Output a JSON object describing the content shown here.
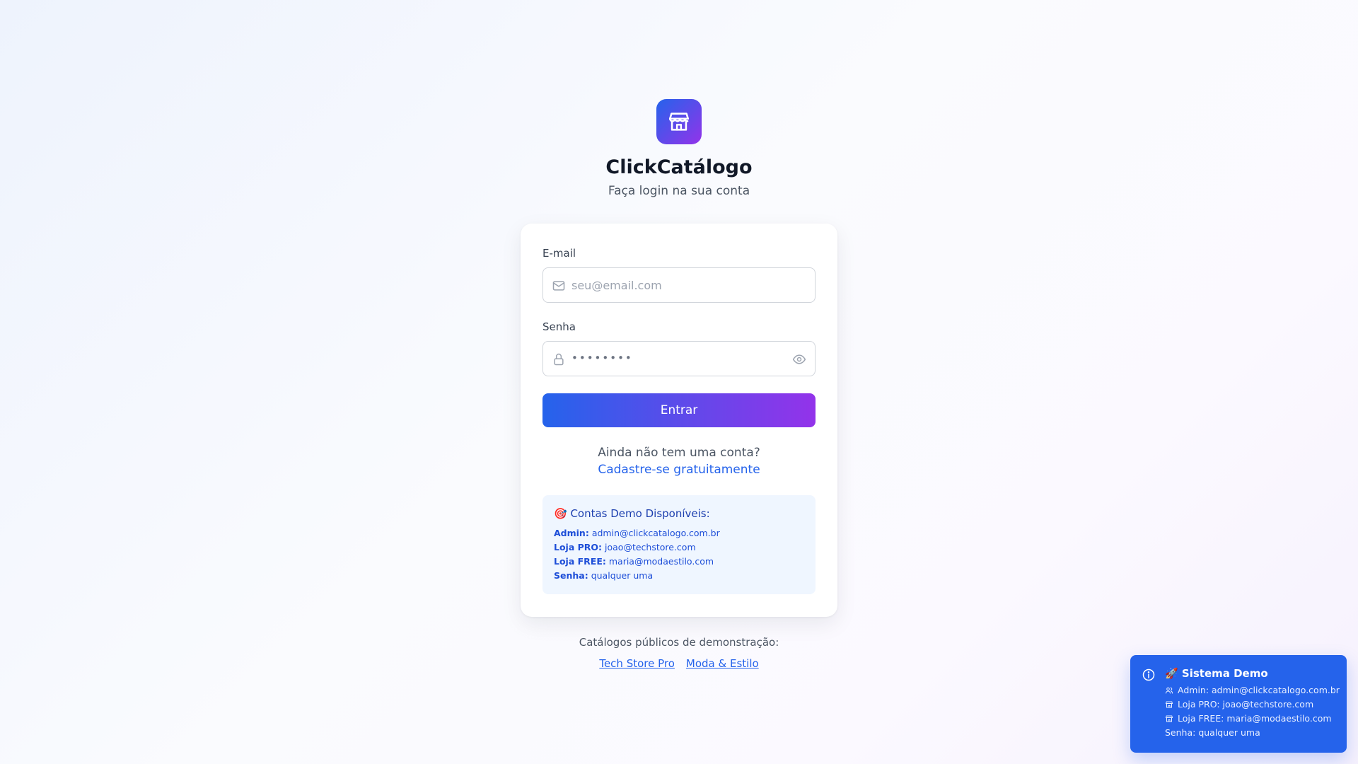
{
  "brand": {
    "title": "ClickCatálogo",
    "subtitle": "Faça login na sua conta"
  },
  "form": {
    "email_label": "E-mail",
    "email_placeholder": "seu@email.com",
    "email_value": "",
    "password_label": "Senha",
    "password_mask": "••••••••",
    "submit_label": "Entrar"
  },
  "signup": {
    "question": "Ainda não tem uma conta?",
    "link": "Cadastre-se gratuitamente"
  },
  "demo_box": {
    "title": "🎯 Contas Demo Disponíveis:",
    "lines": [
      {
        "label": "Admin:",
        "value": "admin@clickcatalogo.com.br"
      },
      {
        "label": "Loja PRO:",
        "value": "joao@techstore.com"
      },
      {
        "label": "Loja FREE:",
        "value": "maria@modaestilo.com"
      },
      {
        "label": "Senha:",
        "value": "qualquer uma"
      }
    ]
  },
  "footer": {
    "text": "Catálogos públicos de demonstração:",
    "links": [
      "Tech Store Pro",
      "Moda & Estilo"
    ]
  },
  "toast": {
    "title": "🚀 Sistema Demo",
    "lines": [
      {
        "icon": "users-icon",
        "text": "Admin: admin@clickcatalogo.com.br"
      },
      {
        "icon": "store-icon",
        "text": "Loja PRO: joao@techstore.com"
      },
      {
        "icon": "store-icon",
        "text": "Loja FREE: maria@modaestilo.com"
      },
      {
        "icon": "",
        "text": "Senha: qualquer uma"
      }
    ]
  },
  "colors": {
    "primary": "#2563eb",
    "accent": "#9333ea",
    "toast_bg": "#2563eb",
    "demo_bg": "#eff6ff"
  }
}
